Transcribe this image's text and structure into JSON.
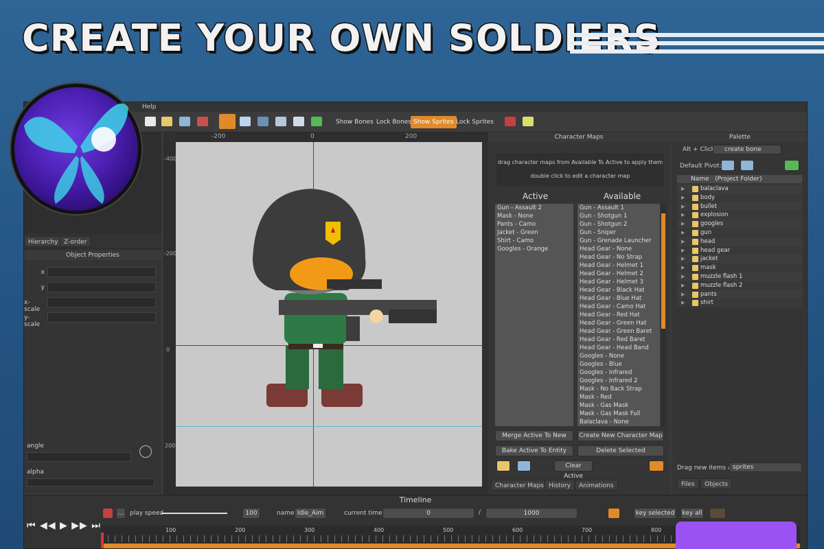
{
  "banner": {
    "headline": "CREATE YOUR OWN SOLDIERS"
  },
  "menubar": {
    "help": "Help"
  },
  "toolbar": {
    "show_bones": "Show Bones",
    "lock_bones": "Lock Bones",
    "show_sprites": "Show Sprites",
    "lock_sprites": "Lock Sprites"
  },
  "left": {
    "tabs": [
      "Hierarchy",
      "Z-order"
    ],
    "object_properties": {
      "title": "Object Properties",
      "fields": [
        "x",
        "y",
        "x-scale",
        "y-scale"
      ],
      "angle": "angle",
      "alpha": "alpha"
    }
  },
  "canvas": {
    "ruler_top": [
      "-200",
      "0",
      "200"
    ],
    "ruler_left": [
      "-400",
      "-200",
      "0",
      "200"
    ]
  },
  "character_maps": {
    "title": "Character Maps",
    "hint_line1": "drag character maps from Available To Active to apply them",
    "hint_line2": "double click to edit a character map",
    "active_label": "Active",
    "available_label": "Available",
    "active": [
      "Gun - Assault 2",
      "Mask - None",
      "Pants - Camo",
      "Jacket - Green",
      "Shirt - Camo",
      "Googles - Orange"
    ],
    "available": [
      "Gun - Assault 1",
      "Gun - Shotgun 1",
      "Gun - Shotgun 2",
      "Gun - Sniper",
      "Gun - Grenade Launcher",
      "Head Gear - None",
      "Head Gear - No Strap",
      "Head Gear - Helmet 1",
      "Head Gear - Helmet 2",
      "Head Gear - Helmet 3",
      "Head Gear - Black Hat",
      "Head Gear - Blue Hat",
      "Head Gear - Camo Hat",
      "Head Gear - Red Hat",
      "Head Gear - Green Hat",
      "Head Gear - Green Baret",
      "Head Gear - Red Baret",
      "Head Gear - Head Band",
      "Googles - None",
      "Googles - Blue",
      "Googles - Infrared",
      "Googles - Infrared 2",
      "Mask - No Back Strap",
      "Mask - Red",
      "Mask - Gas Mask",
      "Mask - Gas Mask Full",
      "Balaclava - None"
    ],
    "buttons": {
      "merge": "Merge Active To New",
      "create": "Create New Character Map",
      "bake": "Bake Active To Entity",
      "delete": "Delete Selected",
      "clear": "Clear Active"
    },
    "tabs": [
      "Character Maps",
      "History",
      "Animations"
    ]
  },
  "palette": {
    "title": "Palette",
    "alt_click_label": "Alt + Click:",
    "alt_click_value": "create bone",
    "default_pivot": "Default Pivot:",
    "tree_header_name": "Name",
    "tree_header_folder": "(Project Folder)",
    "items": [
      "balaclava",
      "body",
      "bullet",
      "explosion",
      "googles",
      "gun",
      "head",
      "head gear",
      "jacket",
      "mask",
      "muzzle flash 1",
      "muzzle flash 2",
      "pants",
      "shirt"
    ],
    "drag_label": "Drag new items as",
    "drag_value": "sprites",
    "tabs": [
      "Files",
      "Objects"
    ]
  },
  "timeline": {
    "title": "Timeline",
    "play_speed_label": "play speed",
    "play_speed_value": "100",
    "name_label": "name",
    "name_value": "Idle_Aim",
    "current_time_label": "current time:",
    "current_time_value": "0",
    "separator": "/",
    "total_time_value": "1000",
    "key_selected": "key selected",
    "key_all": "key all",
    "ticks": [
      "100",
      "200",
      "300",
      "400",
      "500",
      "600",
      "700",
      "800"
    ]
  },
  "colors": {
    "accent": "#e08a2a",
    "background": "#2a5f8e",
    "panel": "#3a3a3a"
  }
}
